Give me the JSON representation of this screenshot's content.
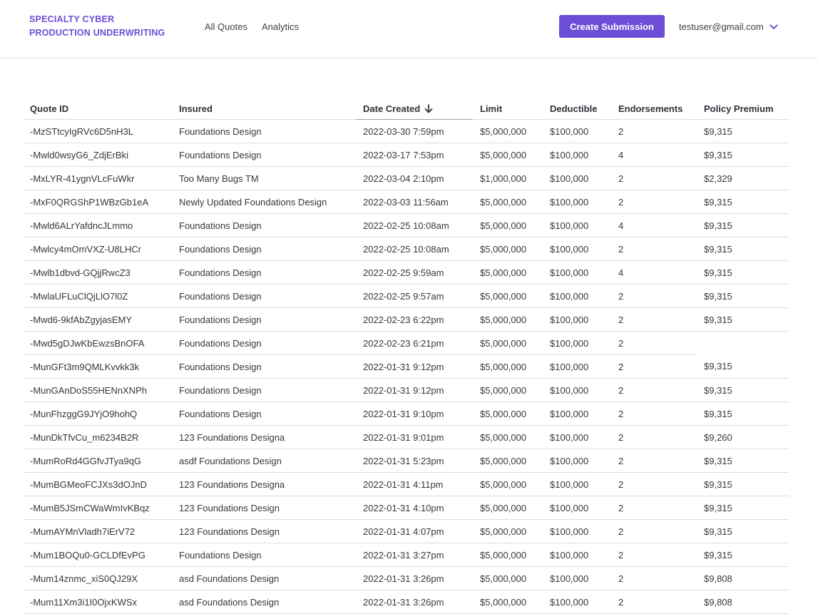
{
  "header": {
    "brand_line1": "SPECIALTY CYBER",
    "brand_line2": "PRODUCTION UNDERWRITING",
    "nav": [
      "All Quotes",
      "Analytics"
    ],
    "create_button": "Create Submission",
    "user_email": "testuser@gmail.com",
    "accent_color": "#6d4ed6"
  },
  "table": {
    "columns": [
      "Quote ID",
      "Insured",
      "Date Created",
      "Limit",
      "Deductible",
      "Endorsements",
      "Policy Premium"
    ],
    "sorted_column": "Date Created",
    "sort_direction": "descending",
    "rows": [
      [
        "-MzSTtcyIgRVc6D5nH3L",
        "Foundations Design",
        "2022-03-30 7:59pm",
        "$5,000,000",
        "$100,000",
        "2",
        "$9,315"
      ],
      [
        "-Mwld0wsyG6_ZdjErBki",
        "Foundations Design",
        "2022-03-17 7:53pm",
        "$5,000,000",
        "$100,000",
        "4",
        "$9,315"
      ],
      [
        "-MxLYR-41ygnVLcFuWkr",
        "Too Many Bugs TM",
        "2022-03-04 2:10pm",
        "$1,000,000",
        "$100,000",
        "2",
        "$2,329"
      ],
      [
        "-MxF0QRGShP1WBzGb1eA",
        "Newly Updated Foundations Design",
        "2022-03-03 11:56am",
        "$5,000,000",
        "$100,000",
        "2",
        "$9,315"
      ],
      [
        "-Mwld6ALrYafdncJLmmo",
        "Foundations Design",
        "2022-02-25 10:08am",
        "$5,000,000",
        "$100,000",
        "4",
        "$9,315"
      ],
      [
        "-Mwlcy4mOmVXZ-U8LHCr",
        "Foundations Design",
        "2022-02-25 10:08am",
        "$5,000,000",
        "$100,000",
        "2",
        "$9,315"
      ],
      [
        "-Mwlb1dbvd-GQjjRwcZ3",
        "Foundations Design",
        "2022-02-25 9:59am",
        "$5,000,000",
        "$100,000",
        "4",
        "$9,315"
      ],
      [
        "-MwlaUFLuClQjLlO7l0Z",
        "Foundations Design",
        "2022-02-25 9:57am",
        "$5,000,000",
        "$100,000",
        "2",
        "$9,315"
      ],
      [
        "-Mwd6-9kfAbZgyjasEMY",
        "Foundations Design",
        "2022-02-23 6:22pm",
        "$5,000,000",
        "$100,000",
        "2",
        "$9,315"
      ],
      [
        "-Mwd5gDJwKbEwzsBnOFA",
        "Foundations Design",
        "2022-02-23 6:21pm",
        "$5,000,000",
        "$100,000",
        "2",
        ""
      ],
      [
        "-MunGFt3m9QMLKvvkk3k",
        "Foundations Design",
        "2022-01-31 9:12pm",
        "$5,000,000",
        "$100,000",
        "2",
        "$9,315"
      ],
      [
        "-MunGAnDoS55HENnXNPh",
        "Foundations Design",
        "2022-01-31 9:12pm",
        "$5,000,000",
        "$100,000",
        "2",
        "$9,315"
      ],
      [
        "-MunFhzggG9JYjO9hohQ",
        "Foundations Design",
        "2022-01-31 9:10pm",
        "$5,000,000",
        "$100,000",
        "2",
        "$9,315"
      ],
      [
        "-MunDkTfvCu_m6234B2R",
        "123 Foundations Designa",
        "2022-01-31 9:01pm",
        "$5,000,000",
        "$100,000",
        "2",
        "$9,260"
      ],
      [
        "-MumRoRd4GGfvJTya9qG",
        "asdf Foundations Design",
        "2022-01-31 5:23pm",
        "$5,000,000",
        "$100,000",
        "2",
        "$9,315"
      ],
      [
        "-MumBGMeoFCJXs3dOJnD",
        "123 Foundations Designa",
        "2022-01-31 4:11pm",
        "$5,000,000",
        "$100,000",
        "2",
        "$9,315"
      ],
      [
        "-MumB5JSmCWaWmIvKBqz",
        "123 Foundations Design",
        "2022-01-31 4:10pm",
        "$5,000,000",
        "$100,000",
        "2",
        "$9,315"
      ],
      [
        "-MumAYMnVladh7iErV72",
        "123 Foundations Design",
        "2022-01-31 4:07pm",
        "$5,000,000",
        "$100,000",
        "2",
        "$9,315"
      ],
      [
        "-Mum1BOQu0-GCLDfEvPG",
        "Foundations Design",
        "2022-01-31 3:27pm",
        "$5,000,000",
        "$100,000",
        "2",
        "$9,315"
      ],
      [
        "-Mum14znmc_xiS0QJ29X",
        "asd Foundations Design",
        "2022-01-31 3:26pm",
        "$5,000,000",
        "$100,000",
        "2",
        "$9,808"
      ],
      [
        "-Mum11Xm3i1I0OjxKWSx",
        "asd Foundations Design",
        "2022-01-31 3:26pm",
        "$5,000,000",
        "$100,000",
        "2",
        "$9,808"
      ]
    ]
  }
}
